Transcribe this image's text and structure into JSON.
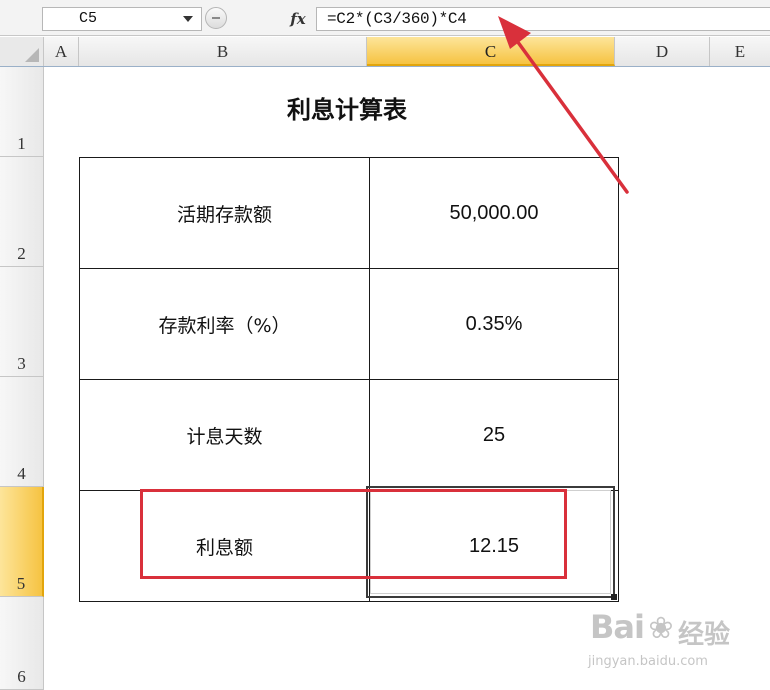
{
  "formula_bar": {
    "name_box": "C5",
    "fx_label": "fx",
    "formula": "=C2*(C3/360)*C4"
  },
  "columns": [
    {
      "label": "A",
      "active": false
    },
    {
      "label": "B",
      "active": false
    },
    {
      "label": "C",
      "active": true
    },
    {
      "label": "D",
      "active": false
    },
    {
      "label": "E",
      "active": false
    }
  ],
  "rows": [
    {
      "label": "1",
      "active": false
    },
    {
      "label": "2",
      "active": false
    },
    {
      "label": "3",
      "active": false
    },
    {
      "label": "4",
      "active": false
    },
    {
      "label": "5",
      "active": true
    },
    {
      "label": "6",
      "active": false
    }
  ],
  "sheet": {
    "title": "利息计算表",
    "table": [
      {
        "label": "活期存款额",
        "value": "50,000.00"
      },
      {
        "label": "存款利率（%）",
        "value": "0.35%"
      },
      {
        "label": "计息天数",
        "value": "25"
      },
      {
        "label": "利息额",
        "value": "12.15"
      }
    ]
  },
  "annotation": {
    "color": "#d9303b"
  },
  "watermark": {
    "logo": "Bai",
    "paw_icon": "baidu-paw-icon",
    "text": "经验",
    "url": "jingyan.baidu.com"
  }
}
